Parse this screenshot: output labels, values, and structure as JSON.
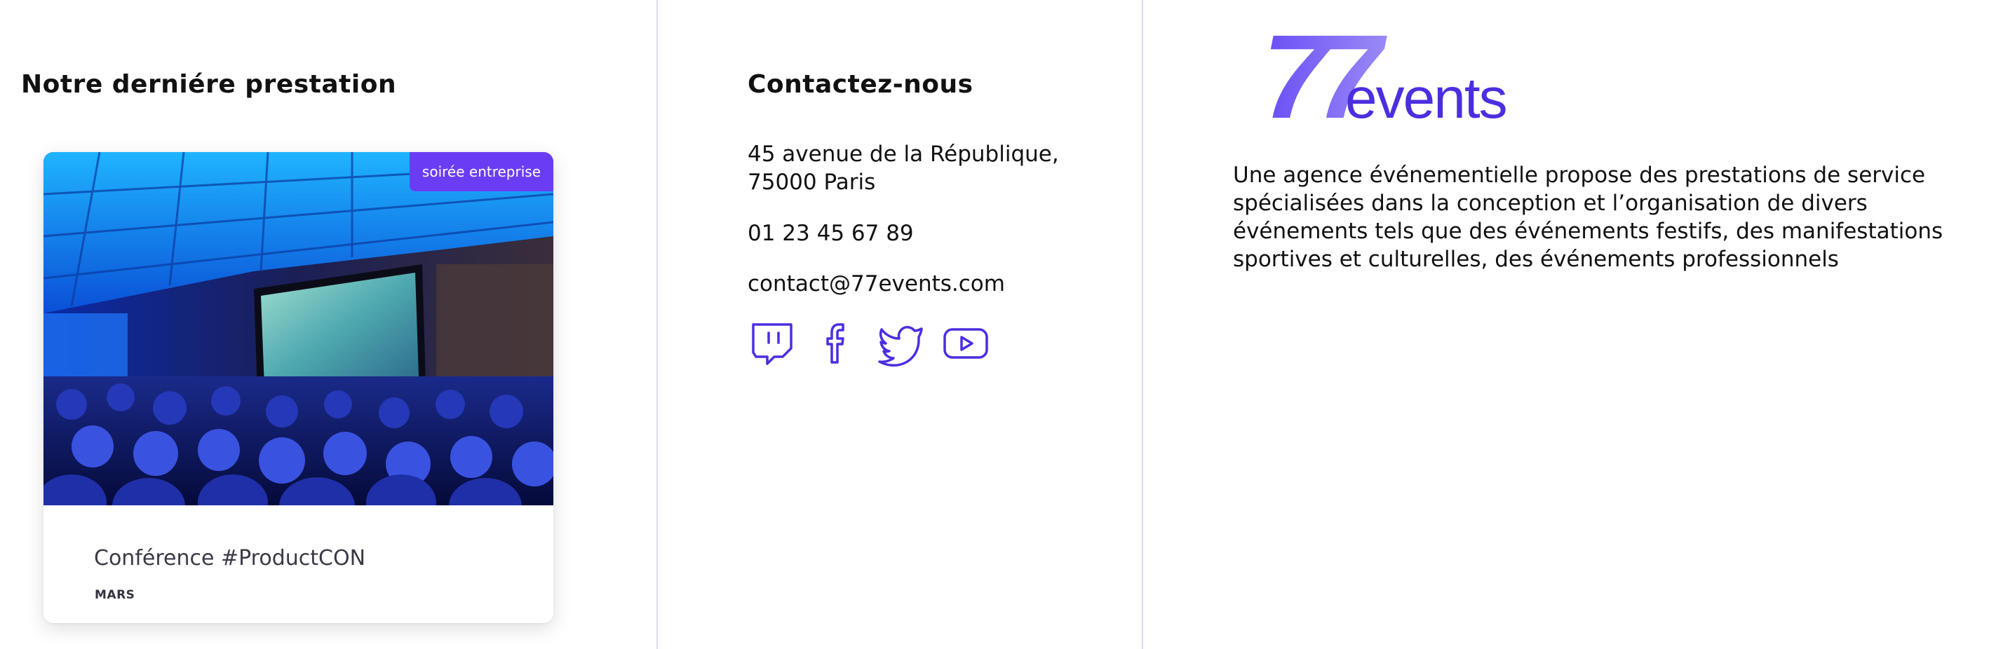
{
  "latest": {
    "title": "Notre derniére prestation",
    "card": {
      "badge": "soirée entreprise",
      "title": "Conférence #ProductCON",
      "month": "MARS"
    }
  },
  "contact": {
    "title": "Contactez-nous",
    "address_line1": "45 avenue de la République,",
    "address_line2": "75000 Paris",
    "phone": "01 23 45 67 89",
    "email": "contact@77events.com",
    "social": [
      "twitch-icon",
      "facebook-icon",
      "twitter-icon",
      "youtube-icon"
    ]
  },
  "about": {
    "logo_number": "77",
    "logo_word": "events",
    "description": "Une agence événementielle propose des prestations de service spécialisées dans la conception et l’organisation de divers événements tels que des événements festifs, des manifestations sportives et culturelles, des événements professionnels"
  },
  "colors": {
    "accent": "#6a3df5",
    "icon_stroke": "#4a2fe0",
    "divider": "#dcdcf0"
  }
}
